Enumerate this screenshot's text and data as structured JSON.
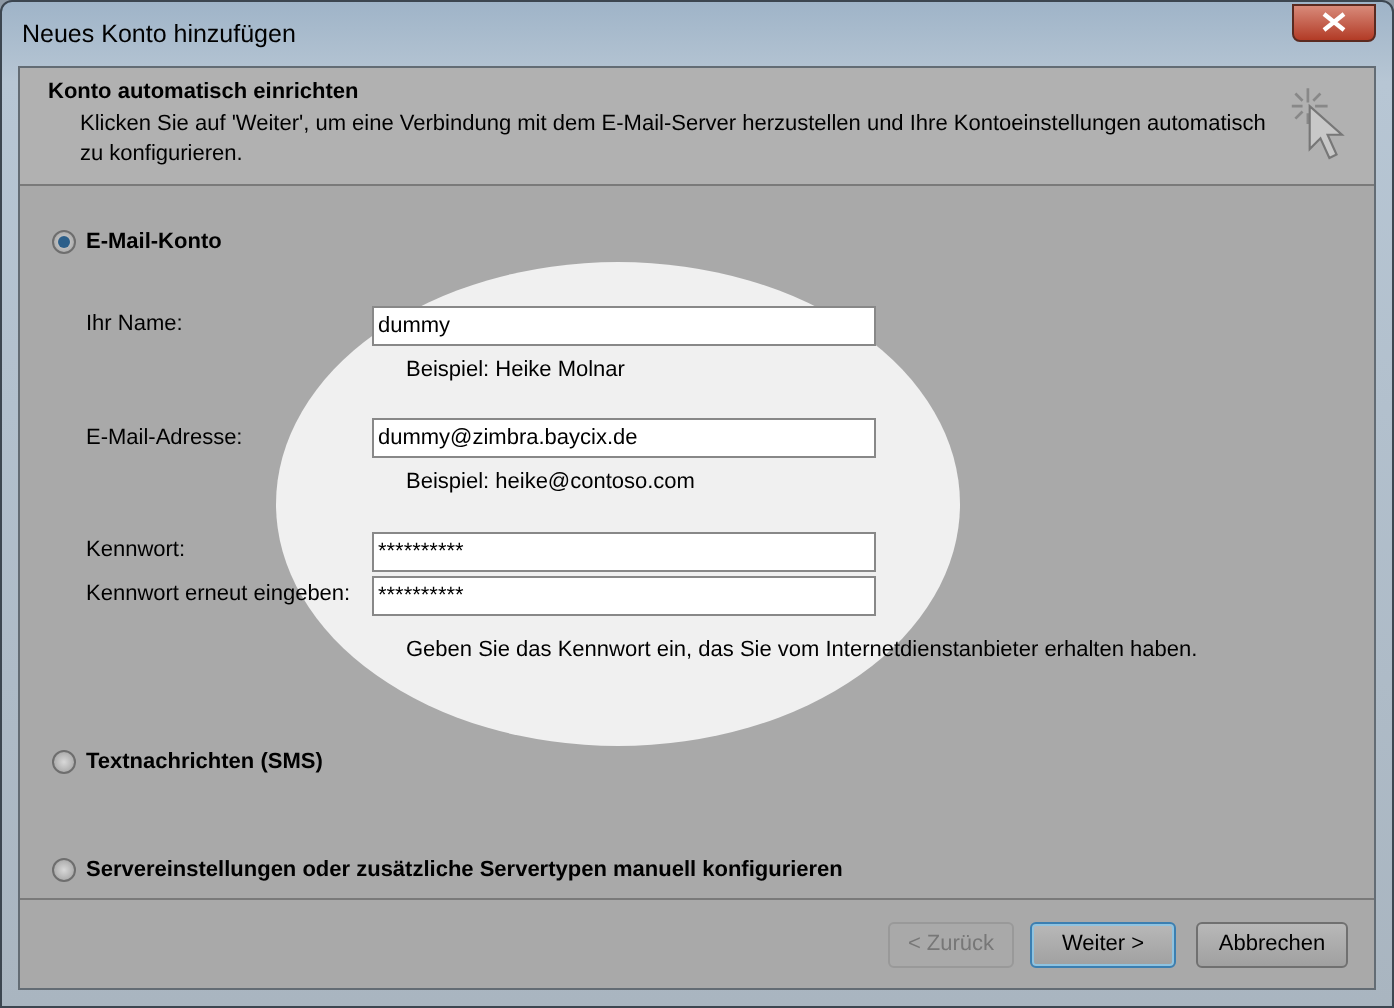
{
  "window": {
    "title": "Neues Konto hinzufügen"
  },
  "header": {
    "title": "Konto automatisch einrichten",
    "description": "Klicken Sie auf 'Weiter', um eine Verbindung mit dem E-Mail-Server herzustellen und Ihre Kontoeinstellungen automatisch zu konfigurieren."
  },
  "options": [
    {
      "label": "E-Mail-Konto",
      "selected": true,
      "fields": [
        {
          "label": "Ihr Name:",
          "value": "dummy",
          "hint": "Beispiel: Heike Molnar",
          "kind": "text"
        },
        {
          "label": "E-Mail-Adresse:",
          "value": "dummy@zimbra.baycix.de",
          "hint": "Beispiel: heike@contoso.com",
          "kind": "text"
        },
        {
          "label": "Kennwort:",
          "value": "**********",
          "kind": "password"
        },
        {
          "label": "Kennwort erneut eingeben:",
          "value": "**********",
          "hint": "Geben Sie das Kennwort ein, das Sie vom Internetdienstanbieter erhalten haben.",
          "kind": "password"
        }
      ]
    },
    {
      "label": "Textnachrichten (SMS)",
      "selected": false
    },
    {
      "label": "Servereinstellungen oder zusätzliche Servertypen manuell konfigurieren",
      "selected": false
    }
  ],
  "buttons": [
    {
      "label": "< Zurück",
      "disabled": true,
      "default": false
    },
    {
      "label": "Weiter >",
      "disabled": false,
      "default": true
    },
    {
      "label": "Abbrechen",
      "disabled": false,
      "default": false
    }
  ]
}
